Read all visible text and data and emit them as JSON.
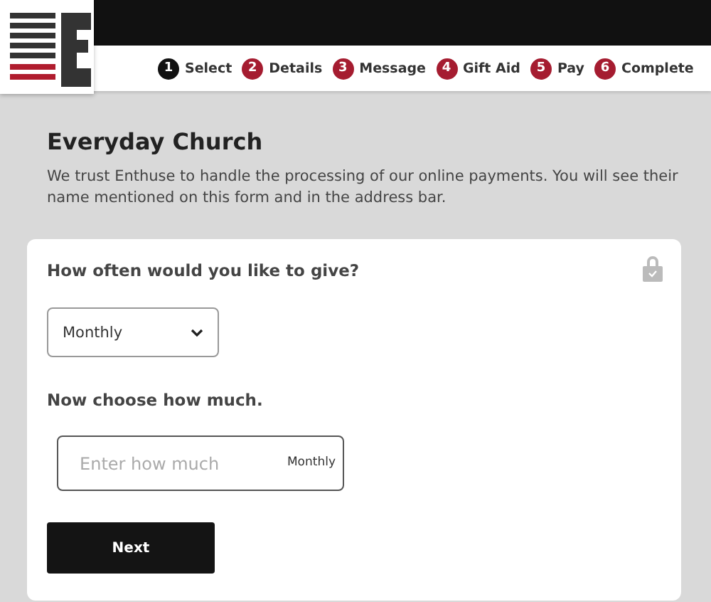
{
  "steps": [
    {
      "number": "1",
      "label": "Select",
      "selected": true
    },
    {
      "number": "2",
      "label": "Details",
      "selected": false
    },
    {
      "number": "3",
      "label": "Message",
      "selected": false
    },
    {
      "number": "4",
      "label": "Gift Aid",
      "selected": false
    },
    {
      "number": "5",
      "label": "Pay",
      "selected": false
    },
    {
      "number": "6",
      "label": "Complete",
      "selected": false
    }
  ],
  "page": {
    "title": "Everyday Church",
    "description": "We trust Enthuse to handle the processing of our online payments. You will see their name mentioned on this form and in the address bar."
  },
  "form": {
    "frequency_question": "How often would you like to give?",
    "frequency": {
      "value": "Monthly"
    },
    "amount_question": "Now choose how much.",
    "amount": {
      "placeholder": "Enter how much",
      "suffix": "Monthly"
    },
    "next_button": "Next"
  }
}
